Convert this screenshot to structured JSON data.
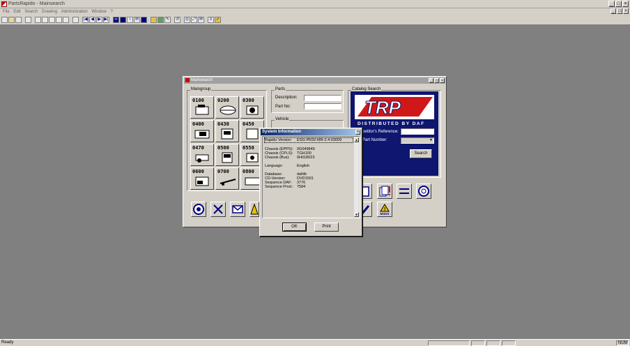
{
  "app": {
    "title": "PartsRapido - Mainsearch",
    "window_buttons": [
      "_",
      "□",
      "×"
    ],
    "mdi_buttons": [
      "_",
      "□",
      "×"
    ]
  },
  "menu": [
    "File",
    "Edit",
    "Search",
    "Drawing",
    "Administration",
    "Window",
    "?"
  ],
  "toolbar_icons": [
    "new-icon",
    "open-icon",
    "save-icon",
    "print-icon",
    "cut-icon",
    "copy-icon",
    "paste-icon",
    "find-icon",
    "first-icon",
    "prev-icon",
    "next-icon",
    "last-icon",
    "binoculars-icon",
    "bookmark-icon",
    "circle-icon",
    "mail-icon",
    "calc-icon",
    "star-icon",
    "box-icon",
    "pen-icon",
    "undo-icon",
    "target-icon",
    "zoom-icon",
    "envelope-icon",
    "list-icon",
    "check-icon"
  ],
  "status": {
    "text": "Ready",
    "num": "NUM"
  },
  "mainsearch": {
    "title": "Mainsearch",
    "maingroup_label": "Maingroup",
    "maingroups": [
      "0100",
      "0200",
      "0300",
      "0400",
      "0430",
      "0450",
      "0470",
      "0500",
      "0550",
      "0600",
      "0700",
      "0800"
    ],
    "parts_label": "Parts",
    "description_label": "Description:",
    "partno_label": "Part No:",
    "vehicle_label": "Vehicle",
    "catalog_label": "Catalog Search",
    "logo_text": "TRP",
    "logo_sub": "DISTRIBUTED BY DAF",
    "competitor_label": "petitor's Reference:",
    "part_number_label": "Part Number:",
    "search_button": "Search",
    "msds_label": "MSDS"
  },
  "dialog": {
    "title": "System Information",
    "close": "×",
    "rows": [
      {
        "k": "Rapido Version:",
        "v": "ESG-PR32-MR-2.4-03009"
      },
      {
        "k": "Chassis (EPPS):",
        "v": "0G049849"
      },
      {
        "k": "Chassis (CPLS):",
        "v": "TGH100"
      },
      {
        "k": "Chassis (Bus):",
        "v": "0H018023"
      },
      {
        "k": "Language:",
        "v": "English"
      },
      {
        "k": "Database:",
        "v": "dafdb"
      },
      {
        "k": "CD-Version:",
        "v": "DVD1501"
      },
      {
        "k": "Sequence DAF:",
        "v": "3776"
      },
      {
        "k": "Sequence Prod.:",
        "v": "7584"
      }
    ],
    "ok_button": "OK",
    "print_button": "Print"
  }
}
